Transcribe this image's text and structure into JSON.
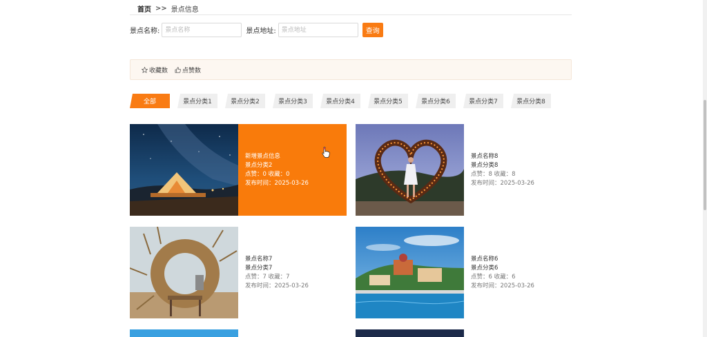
{
  "breadcrumb": {
    "home": "首页",
    "separator": ">>",
    "current": "景点信息"
  },
  "search": {
    "name_label": "景点名称:",
    "name_placeholder": "景点名称",
    "address_label": "景点地址:",
    "address_placeholder": "景点地址",
    "query_button": "查询"
  },
  "sort": {
    "favorites": "收藏数",
    "likes": "点赞数"
  },
  "tabs": [
    "全部",
    "景点分类1",
    "景点分类2",
    "景点分类3",
    "景点分类4",
    "景点分类5",
    "景点分类6",
    "景点分类7",
    "景点分类8"
  ],
  "cards": [
    {
      "name": "新增景点信息",
      "category": "景点分类2",
      "meta": "点赞：0  收藏：0",
      "date": "发布时间：2025-03-26"
    },
    {
      "name": "景点名称8",
      "category": "景点分类8",
      "meta": "点赞：8  收藏：8",
      "date": "发布时间：2025-03-26"
    },
    {
      "name": "景点名称7",
      "category": "景点分类7",
      "meta": "点赞：7  收藏：7",
      "date": "发布时间：2025-03-26"
    },
    {
      "name": "景点名称6",
      "category": "景点分类6",
      "meta": "点赞：6  收藏：6",
      "date": "发布时间：2025-03-26"
    }
  ],
  "colors": {
    "accent": "#f97b13",
    "sort_bar_bg": "#fdf7f1",
    "tab_bg": "#efefef"
  }
}
